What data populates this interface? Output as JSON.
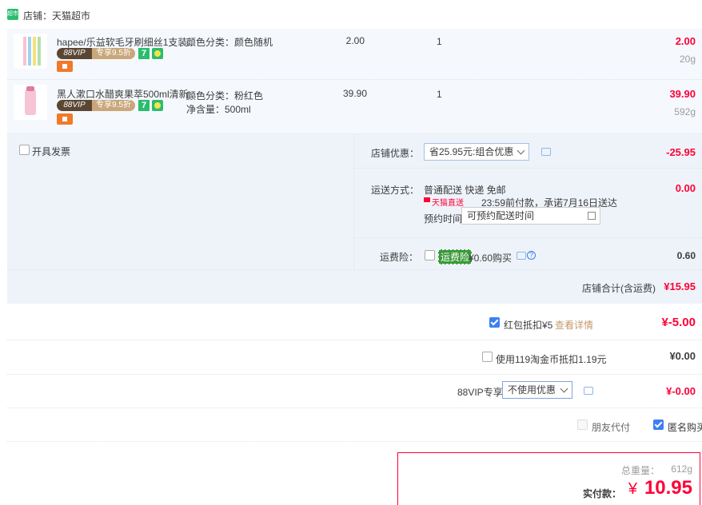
{
  "shop": {
    "label": "店铺：天猫超市",
    "logo_text": "超市"
  },
  "items": [
    {
      "title": "hapee/乐益软毛牙刷细丝1支装...",
      "vip_left": "88VIP",
      "vip_right": "专享9.5折",
      "badge7": "7",
      "attr1": "颜色分类：颜色随机",
      "attr2": "",
      "price": "2.00",
      "qty": "1",
      "subtotal": "2.00",
      "weight": "20g"
    },
    {
      "title": "黑人漱口水醋爽果萃500ml清新...",
      "vip_left": "88VIP",
      "vip_right": "专享9.5折",
      "badge7": "7",
      "attr1": "颜色分类：粉红色",
      "attr2": "净含量：500ml",
      "price": "39.90",
      "qty": "1",
      "subtotal": "39.90",
      "weight": "592g"
    }
  ],
  "invoice": {
    "label": "开具发票"
  },
  "coupon": {
    "label": "店铺优惠：",
    "select_value": "省25.95元:组合优惠",
    "amount": "-25.95"
  },
  "shipping": {
    "label": "运送方式：",
    "method": "普通配送 快递 免邮",
    "tmall_direct": "天猫直送",
    "promise": "23:59前付款，承诺7月16日送达",
    "appoint_label": "预约时间",
    "appoint_placeholder": "可预约配送时间",
    "amount": "0.00"
  },
  "insurance": {
    "label": "运费险：",
    "tag": "运费险",
    "price_text": "¥0.60购买",
    "amount": "0.60"
  },
  "shop_total": {
    "label": "店铺合计(含运费)",
    "amount": "¥15.95"
  },
  "redpacket": {
    "label": "红包抵扣¥5",
    "link": "查看详情",
    "amount": "¥-5.00",
    "checked": true
  },
  "taojinbi": {
    "label": "使用119淘金币抵扣1.19元",
    "amount": "¥0.00",
    "checked": false
  },
  "vip88": {
    "label": "88VIP专享",
    "select_value": "不使用优惠",
    "amount": "¥-0.00"
  },
  "options": {
    "friend_pay": "朋友代付",
    "anonymous": "匿名购买"
  },
  "payment": {
    "weight_label": "总重量：",
    "weight_value": "612g",
    "pay_label": "实付款：",
    "currency": "¥",
    "amount": "10.95"
  },
  "colors": {
    "accent_red": "#ff0036",
    "brand_green": "#2bbd6e",
    "checkbox_blue": "#3d7ef5",
    "row_bg": "#f5f8fd"
  }
}
